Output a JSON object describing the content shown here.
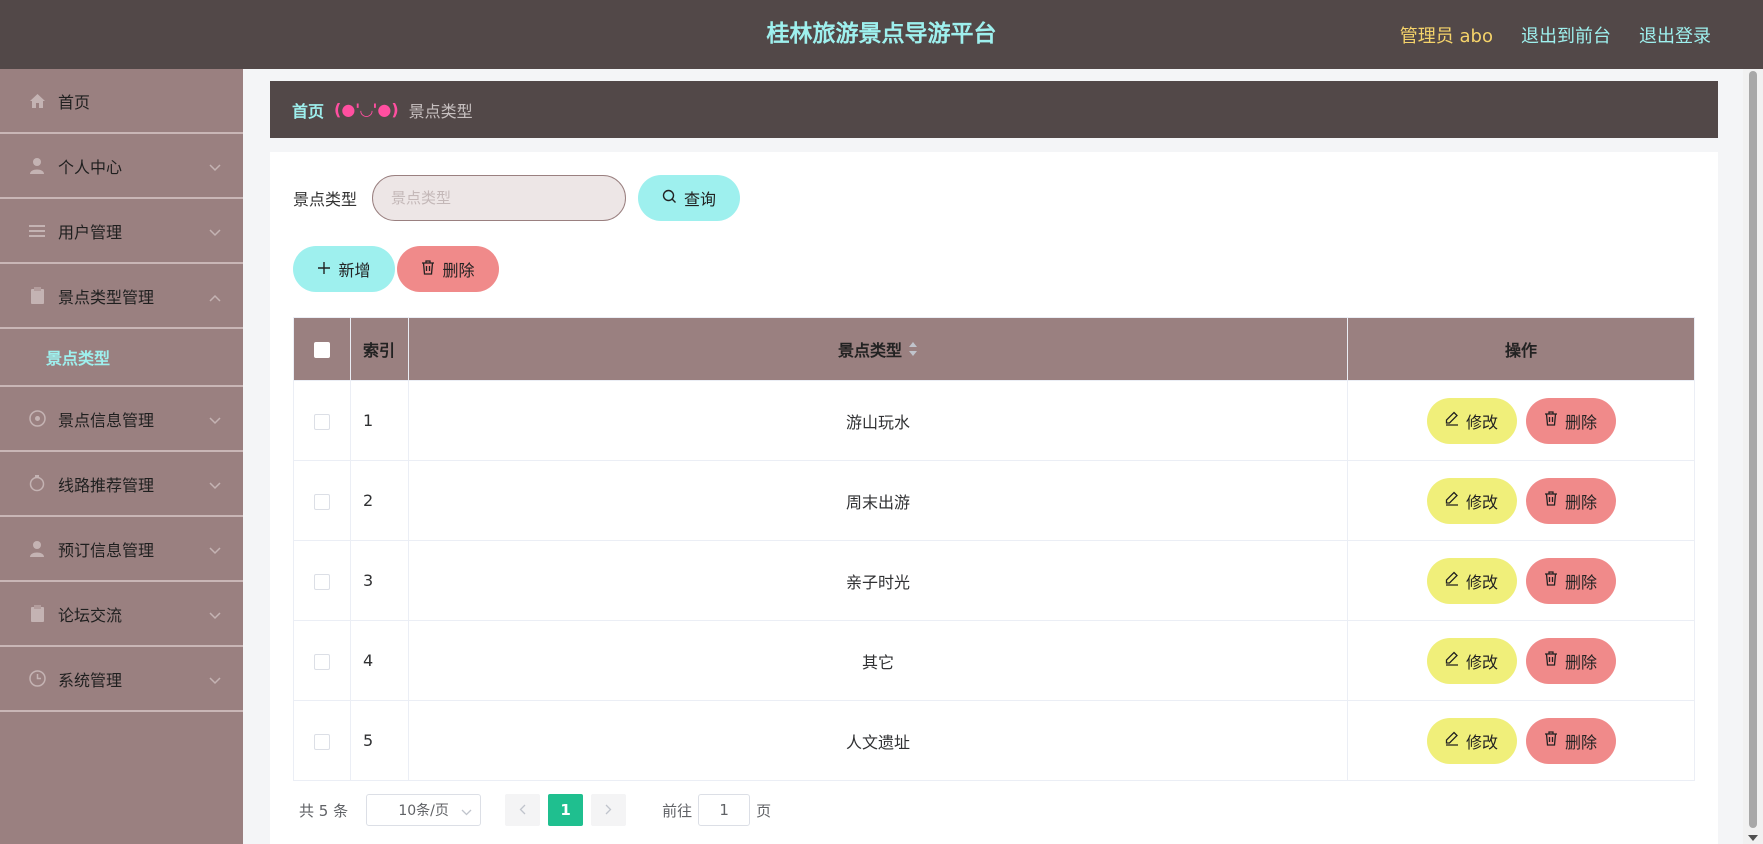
{
  "header": {
    "title": "桂林旅游景点导游平台",
    "user": "管理员 abo",
    "to_front": "退出到前台",
    "logout": "退出登录"
  },
  "sidebar": {
    "items": [
      {
        "label": "首页",
        "icon": "home-icon"
      },
      {
        "label": "个人中心",
        "icon": "user-icon"
      },
      {
        "label": "用户管理",
        "icon": "list-icon"
      },
      {
        "label": "景点类型管理",
        "icon": "clipboard-icon"
      },
      {
        "label": "景点信息管理",
        "icon": "info-icon"
      },
      {
        "label": "线路推荐管理",
        "icon": "route-icon"
      },
      {
        "label": "预订信息管理",
        "icon": "user-icon"
      },
      {
        "label": "论坛交流",
        "icon": "clipboard-icon"
      },
      {
        "label": "系统管理",
        "icon": "clock-icon"
      }
    ],
    "submenu_active": "景点类型"
  },
  "breadcrumb": {
    "home": "首页",
    "separator": "(●'◡'●)",
    "current": "景点类型"
  },
  "search": {
    "label": "景点类型",
    "placeholder": "景点类型",
    "query_label": "查询"
  },
  "actions": {
    "add_label": "新增",
    "delete_label": "删除"
  },
  "table": {
    "columns": {
      "index": "索引",
      "type": "景点类型",
      "ops": "操作"
    },
    "rows": [
      {
        "index": "1",
        "type": "游山玩水"
      },
      {
        "index": "2",
        "type": "周末出游"
      },
      {
        "index": "3",
        "type": "亲子时光"
      },
      {
        "index": "4",
        "type": "其它"
      },
      {
        "index": "5",
        "type": "人文遗址"
      }
    ],
    "edit_label": "修改",
    "delete_label": "删除"
  },
  "pagination": {
    "total": "共 5 条",
    "page_size": "10条/页",
    "current_page": "1",
    "goto_label": "前往",
    "goto_value": "1",
    "page_suffix": "页"
  },
  "colors": {
    "header_bg": "#524848",
    "sidebar_bg": "#9a8080",
    "accent_cyan": "#9ef0ee",
    "accent_yellow": "#f0ef7a",
    "accent_red": "#f08a8a",
    "pager_active": "#1fbf8f"
  }
}
